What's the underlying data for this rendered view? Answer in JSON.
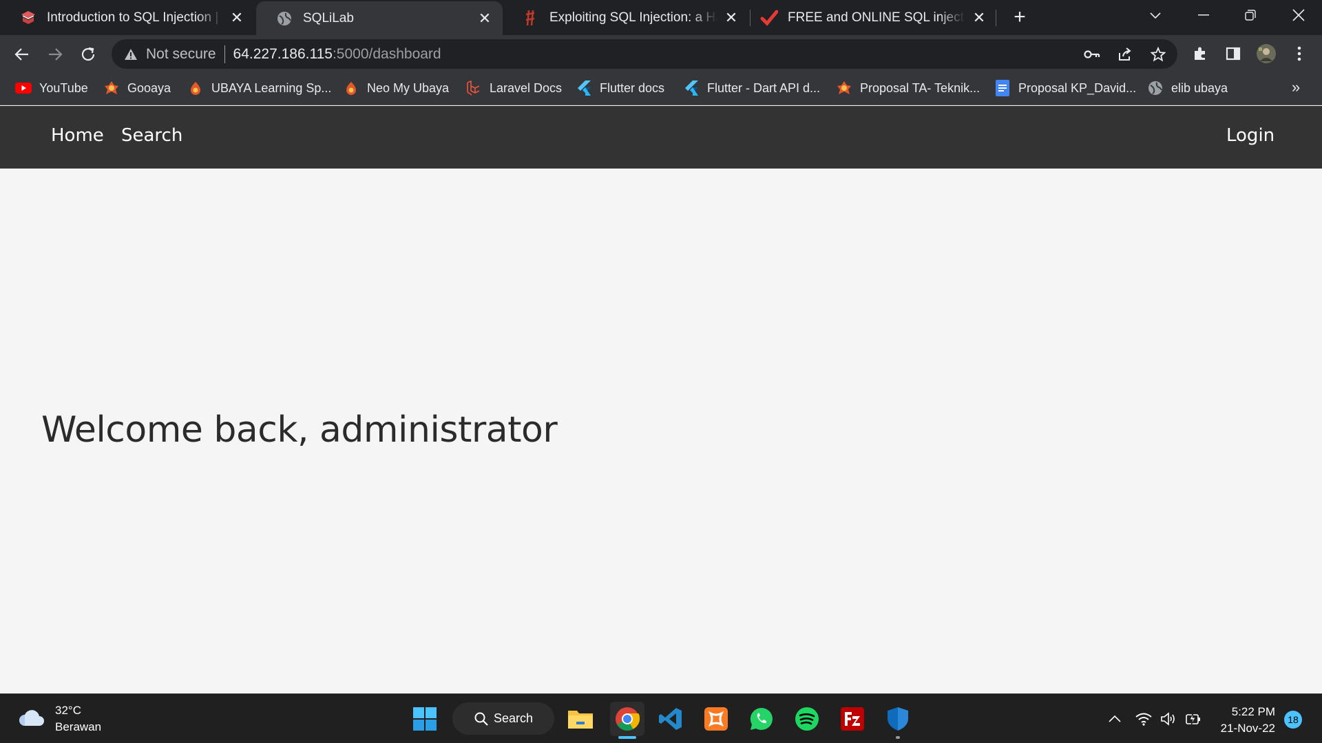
{
  "browser": {
    "tabs": [
      {
        "title": "Introduction to SQL Injection | St",
        "favicon": "book-icon",
        "active": false
      },
      {
        "title": "SQLiLab",
        "favicon": "globe-icon",
        "active": true
      },
      {
        "title": "Exploiting SQL Injection: a Hands",
        "favicon": "rune-icon",
        "active": false
      },
      {
        "title": "FREE and ONLINE SQL injection S",
        "favicon": "checkmark-icon",
        "active": false
      }
    ],
    "omnibox": {
      "security_label": "Not secure",
      "host": "64.227.186.115",
      "path": ":5000/dashboard"
    },
    "bookmarks": [
      {
        "label": "YouTube",
        "icon": "youtube-icon"
      },
      {
        "label": "Gooaya",
        "icon": "ubaya-icon"
      },
      {
        "label": "UBAYA Learning Sp...",
        "icon": "ubaya-icon"
      },
      {
        "label": "Neo My Ubaya",
        "icon": "ubaya-icon"
      },
      {
        "label": "Laravel Docs",
        "icon": "laravel-icon"
      },
      {
        "label": "Flutter docs",
        "icon": "flutter-icon"
      },
      {
        "label": "Flutter - Dart API d...",
        "icon": "flutter-icon"
      },
      {
        "label": "Proposal TA- Teknik...",
        "icon": "ubaya-icon"
      },
      {
        "label": "Proposal KP_David...",
        "icon": "docs-icon"
      },
      {
        "label": "elib ubaya",
        "icon": "globe-icon"
      }
    ],
    "bookmarks_more": "»"
  },
  "site": {
    "nav": {
      "home": "Home",
      "search": "Search",
      "login": "Login"
    },
    "welcome": "Welcome back, administrator"
  },
  "taskbar": {
    "weather": {
      "temp": "32°C",
      "condition": "Berawan"
    },
    "search_label": "Search",
    "clock": {
      "time": "5:22 PM",
      "date": "21-Nov-22"
    },
    "notifications": "18"
  },
  "colors": {
    "accent_blue": "#4cc2ff",
    "site_nav_bg": "#333333",
    "page_bg": "#f5f5f5"
  }
}
